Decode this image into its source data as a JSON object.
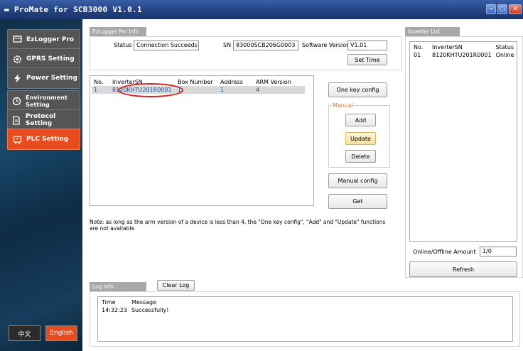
{
  "window": {
    "title": "ProMate for SCB3000 V1.0.1"
  },
  "sidebar": {
    "items": [
      {
        "label": "EzLogger Pro",
        "icon": "monitor-icon"
      },
      {
        "label": "GPRS Setting",
        "icon": "gear-icon"
      },
      {
        "label": "Power Setting",
        "icon": "lightning-icon"
      },
      {
        "label": "Environment Setting",
        "icon": "clock-icon"
      },
      {
        "label": "Protocol Setting",
        "icon": "document-icon"
      },
      {
        "label": "PLC Setting",
        "icon": "plc-icon",
        "active": true
      }
    ],
    "lang_cn": "中文",
    "lang_en": "English"
  },
  "ezlogger": {
    "tab": "EzLogger Pro Info",
    "status_label": "Status",
    "status_value": "Connection Succeeds",
    "sn_label": "SN",
    "sn_value": "83000SCB206G0003",
    "sw_label": "Software Version",
    "sw_value": "V1.01",
    "set_time": "Set Time"
  },
  "device_table": {
    "headers": [
      "No.",
      "InverterSN",
      "Box Number",
      "Address",
      "ARM Version"
    ],
    "rows": [
      [
        "1",
        "8120KHTU201R0001",
        "1",
        "1",
        "4"
      ]
    ]
  },
  "buttons": {
    "one_key": "One key config",
    "manual_group": "Manual",
    "add": "Add",
    "update": "Update",
    "delete": "Delete",
    "manual_config": "Manual config",
    "get": "Get"
  },
  "note": "Note: as long as the arm version of a device is less than 4, the \"One key config\", \"Add\" and \"Update\" functions are not available",
  "inverter_list": {
    "tab": "Inverter List",
    "headers": [
      "No.",
      "InverterSN",
      "Status"
    ],
    "rows": [
      [
        "01",
        "8120KHTU201R0001",
        "Online"
      ]
    ],
    "amount_label": "Online/Offline Amount",
    "amount_value": "1/0",
    "refresh": "Refresh"
  },
  "log": {
    "tab": "Log Info",
    "clear": "Clear Log",
    "headers": [
      "Time",
      "Message"
    ],
    "rows": [
      [
        "14:32:23",
        "Successfully!"
      ]
    ]
  },
  "colors": {
    "accent": "#e74b1e",
    "highlight_circle": "#d02020",
    "selected_row": "#d9d9d9"
  }
}
